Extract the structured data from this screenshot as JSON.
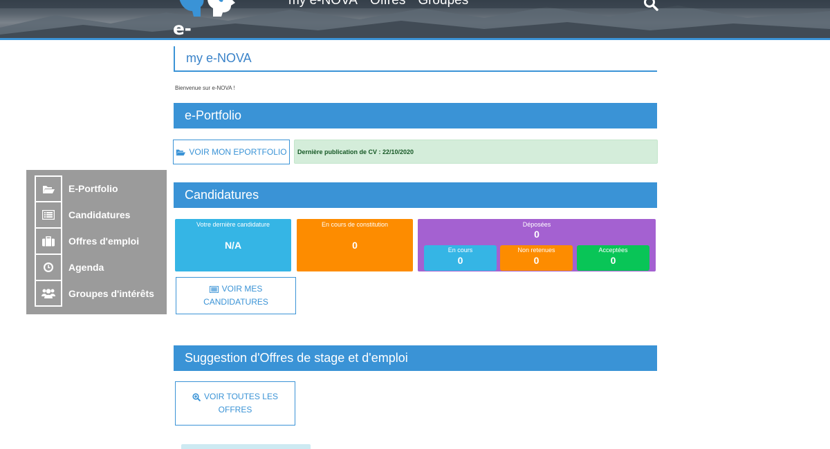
{
  "header": {
    "logo_text": "e-NOVA",
    "nav": [
      "my e-NOVA",
      "Offres",
      "Groupes"
    ],
    "search_icon": "search-icon"
  },
  "side_menu": [
    {
      "label": "E-Portfolio",
      "icon": "folder-open-icon"
    },
    {
      "label": "Candidatures",
      "icon": "list-icon"
    },
    {
      "label": "Offres d'emploi",
      "icon": "briefcase-icon"
    },
    {
      "label": "Agenda",
      "icon": "clock-icon"
    },
    {
      "label": "Groupes d'intérêts",
      "icon": "users-icon"
    }
  ],
  "page": {
    "title": "my e-NOVA",
    "welcome": "Bienvenue sur e-NOVA !"
  },
  "eportfolio": {
    "heading": "e-Portfolio",
    "button": "VOIR MON EPORTFOLIO",
    "last_publication": "Dernière publication de CV : 22/10/2020"
  },
  "candidatures": {
    "heading": "Candidatures",
    "last": {
      "label": "Votre dernière candidature",
      "value": "N/A"
    },
    "in_progress": {
      "label": "En cours de constitution",
      "value": "0"
    },
    "submitted": {
      "label": "Déposées",
      "value": "0",
      "en_cours": {
        "label": "En cours",
        "value": "0"
      },
      "non_retenues": {
        "label": "Non retenues",
        "value": "0"
      },
      "acceptees": {
        "label": "Acceptées",
        "value": "0"
      }
    },
    "button_line1": "VOIR MES",
    "button_line2": "CANDIDATURES"
  },
  "suggestions": {
    "heading": "Suggestion d'Offres de stage et d'emploi",
    "button_line1": "VOIR TOUTES LES",
    "button_line2": "OFFRES"
  },
  "colors": {
    "primary": "#3a93d6",
    "tile_blue": "#35b5e5",
    "tile_orange": "#fd8c00",
    "tile_purple": "#a461d1",
    "tile_green": "#09c557",
    "side_menu": "#9b9b9b"
  }
}
